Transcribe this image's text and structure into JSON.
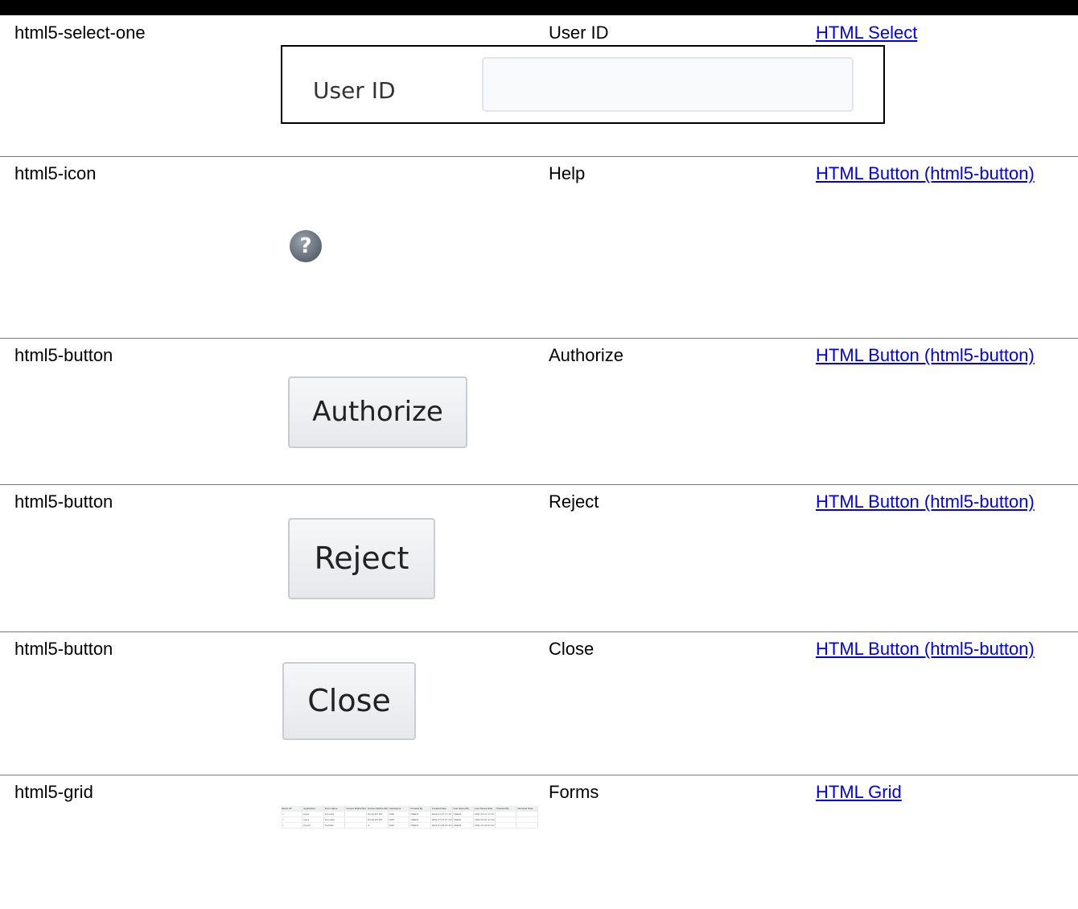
{
  "rows": [
    {
      "type": "html5-select-one",
      "label": "User ID",
      "link": "HTML Select",
      "sample": {
        "field_label": "User ID",
        "value": ""
      }
    },
    {
      "type": "html5-icon",
      "label": "Help",
      "link": "HTML Button (html5-button)",
      "sample": {
        "glyph": "?",
        "icon": "help-icon"
      }
    },
    {
      "type": "html5-button",
      "label": "Authorize",
      "link": "HTML Button (html5-button)",
      "sample": {
        "button_label": "Authorize"
      }
    },
    {
      "type": "html5-button",
      "label": "Reject",
      "link": "HTML Button (html5-button)",
      "sample": {
        "button_label": "Reject"
      }
    },
    {
      "type": "html5-button",
      "label": "Close",
      "link": "HTML Button (html5-button)",
      "sample": {
        "button_label": "Close"
      }
    },
    {
      "type": "html5-grid",
      "label": "Forms",
      "link": "HTML Grid",
      "sample": {
        "columns": [
          "Select All",
          "Application",
          "Form Name",
          "Access Rights Before",
          "Access Rights After",
          "Operations",
          "Created By",
          "Created Date",
          "Last Saved By",
          "Last Saved Date",
          "Checked By",
          "Checked Date"
        ],
        "rows": [
          [
            "",
            "App1",
            "Forms01",
            "",
            "DV,Dv,DX,DD",
            "ADD",
            "USER1",
            "2021-07-27 17:13:12",
            "USER1",
            "2021-07-27 17:13:12",
            "",
            ""
          ],
          [
            "",
            "App1",
            "Forms02",
            "",
            "DV,Dv,DX,DD",
            "ADD",
            "USER1",
            "2021-07-27 17:14:50",
            "USER1",
            "2021-07-27 17:14:50",
            "",
            ""
          ],
          [
            "",
            "App13",
            "Test200",
            "",
            "vl",
            "ADD",
            "USER1",
            "2021-07-29 07:41:04",
            "USER1",
            "2021-07-29 07:41:04",
            "",
            ""
          ]
        ]
      }
    }
  ],
  "colors": {
    "link": "#0000ee",
    "topbar": "#000000",
    "separator": "#777777"
  }
}
